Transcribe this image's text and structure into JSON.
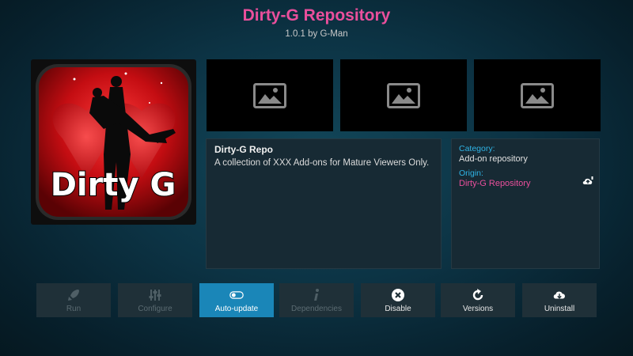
{
  "header": {
    "title": "Dirty-G Repository",
    "subtitle": "1.0.1 by G-Man"
  },
  "poster": {
    "logo_text": "Dirty G"
  },
  "description": {
    "title": "Dirty-G Repo",
    "text": "A collection of XXX Add-ons for Mature Viewers Only."
  },
  "info": {
    "category_label": "Category:",
    "category_value": "Add-on repository",
    "origin_label": "Origin:",
    "origin_value": "Dirty-G Repository"
  },
  "buttons": [
    {
      "label": "Run",
      "icon": "rocket-icon",
      "enabled": false
    },
    {
      "label": "Configure",
      "icon": "sliders-icon",
      "enabled": false
    },
    {
      "label": "Auto-update",
      "icon": "toggle-icon",
      "enabled": true,
      "focused": true
    },
    {
      "label": "Dependencies",
      "icon": "info-icon",
      "enabled": false
    },
    {
      "label": "Disable",
      "icon": "close-circle-icon",
      "enabled": true
    },
    {
      "label": "Versions",
      "icon": "refresh-icon",
      "enabled": true
    },
    {
      "label": "Uninstall",
      "icon": "cloud-download-icon",
      "enabled": true
    }
  ],
  "colors": {
    "accent_pink": "#ea4f9c",
    "accent_blue": "#2fb4e6",
    "focus_button": "#1a86b8"
  }
}
